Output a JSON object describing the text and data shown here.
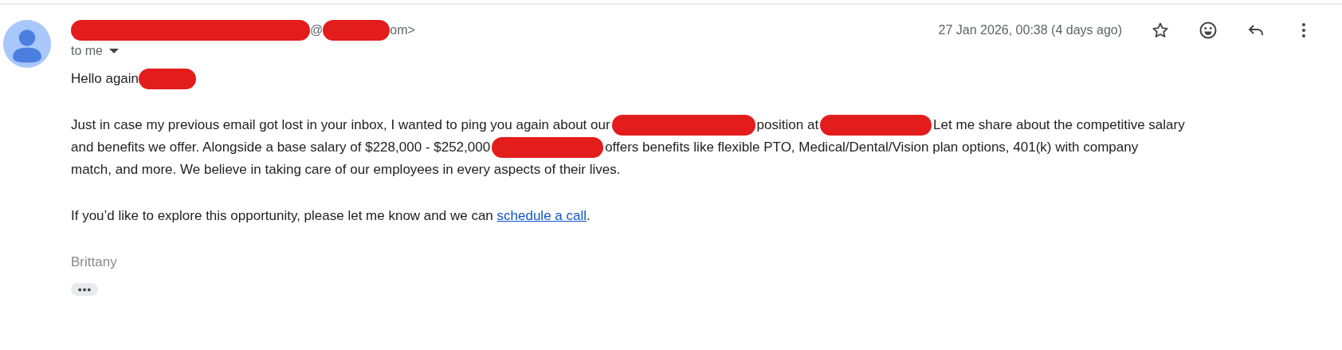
{
  "message": {
    "sender": [
      {
        "kind": "redaction"
      },
      {
        "kind": "text",
        "text": "@"
      },
      {
        "kind": "redaction"
      },
      {
        "kind": "text",
        "text": "om>"
      }
    ],
    "recipient": "to me",
    "date": "27 Jan 2026, 00:38 (4 days ago)",
    "greeting": [
      {
        "kind": "text",
        "text": "Hello again"
      },
      {
        "kind": "redaction"
      }
    ],
    "paragraph": [
      [
        {
          "kind": "text",
          "text": "Just in case my previous email got lost in your inbox, I wanted to ping you again about our"
        },
        {
          "kind": "redaction"
        },
        {
          "kind": "text",
          "text": "position at"
        },
        {
          "kind": "redaction"
        },
        {
          "kind": "text",
          "text": "Let me share about the competitive salary"
        }
      ],
      [
        {
          "kind": "text",
          "text": "and benefits we offer. Alongside a base salary of $228,000 - $252,000"
        },
        {
          "kind": "redaction"
        },
        {
          "kind": "text",
          "text": "offers benefits like flexible PTO, Medical/Dental/Vision plan options, 401(k) with company"
        }
      ],
      [
        {
          "kind": "text",
          "text": "match, and more. We believe in taking care of our employees in every aspects of their lives."
        }
      ]
    ],
    "closing": {
      "text": "If you’d like to explore this opportunity, please let me know and we can",
      "link": "schedule a call",
      "end": "."
    },
    "signature": "Brittany"
  }
}
